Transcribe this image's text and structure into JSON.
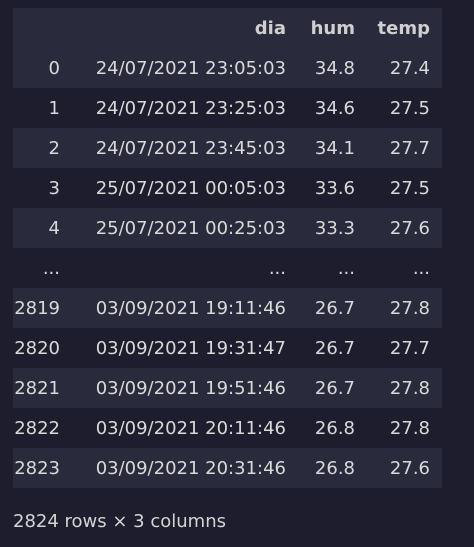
{
  "table": {
    "columns": [
      "",
      "dia",
      "hum",
      "temp"
    ],
    "rows": [
      [
        "0",
        "24/07/2021 23:05:03",
        "34.8",
        "27.4"
      ],
      [
        "1",
        "24/07/2021 23:25:03",
        "34.6",
        "27.5"
      ],
      [
        "2",
        "24/07/2021 23:45:03",
        "34.1",
        "27.7"
      ],
      [
        "3",
        "25/07/2021 00:05:03",
        "33.6",
        "27.5"
      ],
      [
        "4",
        "25/07/2021 00:25:03",
        "33.3",
        "27.6"
      ],
      [
        "...",
        "...",
        "...",
        "..."
      ],
      [
        "2819",
        "03/09/2021 19:11:46",
        "26.7",
        "27.8"
      ],
      [
        "2820",
        "03/09/2021 19:31:47",
        "26.7",
        "27.7"
      ],
      [
        "2821",
        "03/09/2021 19:51:46",
        "26.7",
        "27.8"
      ],
      [
        "2822",
        "03/09/2021 20:11:46",
        "26.8",
        "27.8"
      ],
      [
        "2823",
        "03/09/2021 20:31:46",
        "26.8",
        "27.6"
      ]
    ]
  },
  "footer": {
    "summary": "2824 rows × 3 columns"
  }
}
